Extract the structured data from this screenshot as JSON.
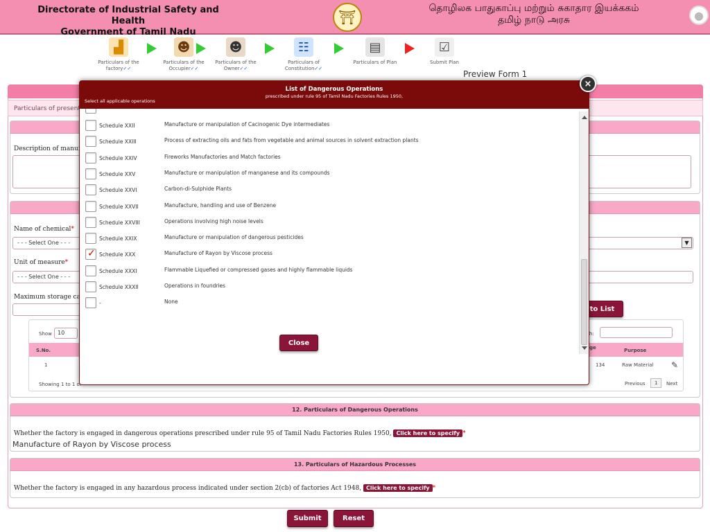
{
  "header": {
    "title_en_line1": "Directorate of Industrial Safety and Health",
    "title_en_line2": "Government of Tamil Nadu",
    "title_ta_line1": "தொழிலக பாதுகாப்பு மற்றும் சுகாதார இயக்ககம்",
    "title_ta_line2": "தமிழ் நாடு அரசு"
  },
  "steps": [
    {
      "label": "Particulars of the factory",
      "tick": "✓✓",
      "icon": "factory-icon"
    },
    {
      "label": "Particulars of the Occupier",
      "tick": "✓✓",
      "icon": "occupier-icon"
    },
    {
      "label": "Particulars of the Owner",
      "tick": "✓✓",
      "icon": "owner-icon"
    },
    {
      "label": "Particulars of Constitution",
      "tick": "✓✓",
      "icon": "constitution-icon"
    },
    {
      "label": "Particulars of Plan",
      "tick": "",
      "icon": "plan-icon"
    },
    {
      "label": "Submit Plan",
      "tick": "",
      "icon": "submit-plan-icon"
    }
  ],
  "preview_title": "Preview Form 1",
  "form": {
    "sub_bar": "Particulars of present",
    "description_label": "Description of manufact",
    "chemical_label": "Name of chemical",
    "chemical_select": "- - - Select One - - -",
    "unit_label": "Unit of measure",
    "unit_select": "- - - Select One - - -",
    "max_storage_label": "Maximum storage capa",
    "add_to_list": "to List",
    "table": {
      "show_label": "Show",
      "show_value": "10",
      "search_label": "ch:",
      "col_sno": "S.No.",
      "col_ge": "ge",
      "col_purpose": "Purpose",
      "row_sno": "1",
      "row_qty": "134",
      "row_purpose": "Raw Material",
      "footer_info": "Showing 1 to 1 of",
      "prev": "Previous",
      "page": "1",
      "next": "Next"
    },
    "section12": {
      "title": "12. Particulars of Dangerous Operations",
      "question": "Whether the factory is engaged in dangerous operations prescribed under rule 95 of Tamil Nadu Factories Rules 1950,",
      "link": "Click here to specify",
      "answer": "Manufacture of Rayon by Viscose process"
    },
    "section13": {
      "title": "13. Particulars of Hazardous Processes",
      "question": "Whether the factory is engaged in any hazardous process indicated under section 2(cb) of factories Act 1948,",
      "link": "Click here to specify"
    },
    "submit": "Submit",
    "reset": "Reset"
  },
  "modal": {
    "title": "List of Dangerous Operations",
    "subtitle": "prescribed under rule 95 of Tamil Nadu Factories Rules 1950,",
    "select_all": "Select all applicable operations",
    "close_label": "Close",
    "rows": [
      {
        "schedule": "Schedule XXII",
        "desc": "Manufacture or manipulation of Cacinogenic Dye intermediates",
        "checked": false
      },
      {
        "schedule": "Schedule XXIII",
        "desc": "Process of extracting oils and fats from vegetable and animal sources in solvent extraction plants",
        "checked": false
      },
      {
        "schedule": "Schedule XXIV",
        "desc": "Fireworks Manufactories and Match factories",
        "checked": false
      },
      {
        "schedule": "Schedule XXV",
        "desc": "Manufacture or manipulation of manganese and its compounds",
        "checked": false
      },
      {
        "schedule": "Schedule XXVI",
        "desc": "Carbon-di-Sulphide Plants",
        "checked": false
      },
      {
        "schedule": "Schedule XXVII",
        "desc": "Manufacture, handling and use of Benzene",
        "checked": false
      },
      {
        "schedule": "Schedule XXVIII",
        "desc": "Operations involving high noise levels",
        "checked": false
      },
      {
        "schedule": "Schedule XXIX",
        "desc": "Manufacture or manipulation of dangerous pesticides",
        "checked": false
      },
      {
        "schedule": "Schedule XXX",
        "desc": "Manufacture of Rayon by Viscose process",
        "checked": true
      },
      {
        "schedule": "Schedule XXXI",
        "desc": "Flammable Liquefied or compressed gases and highly flammable liquids",
        "checked": false
      },
      {
        "schedule": "Schedule XXXII",
        "desc": "Operations in foundries",
        "checked": false
      },
      {
        "schedule": "-",
        "desc": "None",
        "checked": false
      }
    ]
  }
}
